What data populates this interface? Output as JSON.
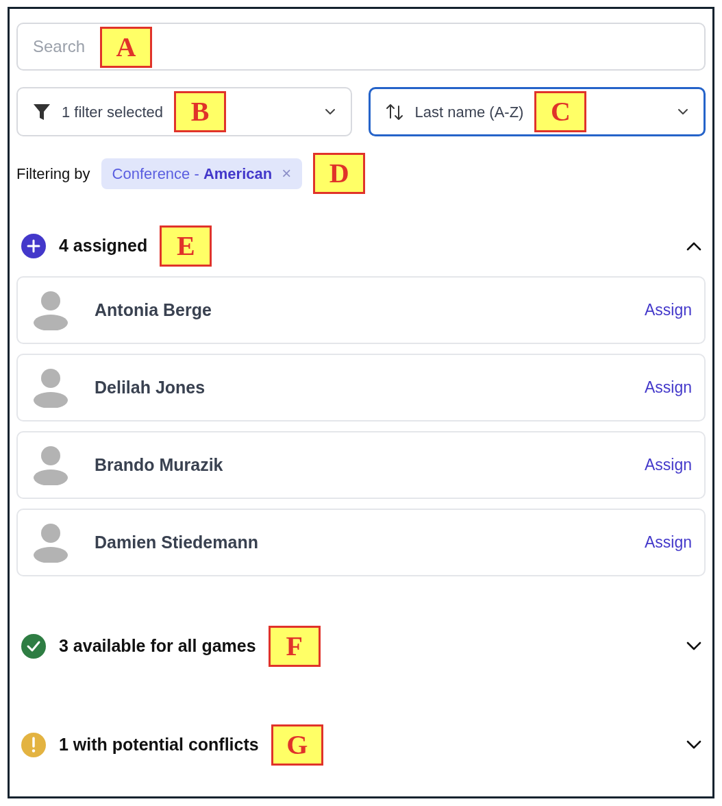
{
  "search": {
    "placeholder": "Search",
    "callout": "A"
  },
  "filter_dropdown": {
    "label": "1 filter selected",
    "focused": false,
    "callout": "B"
  },
  "sort_dropdown": {
    "label": "Last name (A-Z)",
    "focused": true,
    "callout": "C"
  },
  "active_filters": {
    "label": "Filtering by",
    "chips": [
      {
        "text": "Conference - **American**",
        "remove": "×"
      }
    ],
    "callout": "D"
  },
  "sections": [
    {
      "kind": "assigned",
      "title": "4 assigned",
      "expanded": true,
      "callout": "E",
      "people": [
        {
          "name": "Antonia Berge",
          "action": "Assign"
        },
        {
          "name": "Delilah Jones",
          "action": "Assign"
        },
        {
          "name": "Brando Murazik",
          "action": "Assign"
        },
        {
          "name": "Damien Stiedemann",
          "action": "Assign"
        }
      ]
    },
    {
      "kind": "available",
      "title": "3 available for all games",
      "expanded": false,
      "callout": "F"
    },
    {
      "kind": "conflicts",
      "title": "1 with potential conflicts",
      "expanded": false,
      "callout": "G"
    }
  ]
}
